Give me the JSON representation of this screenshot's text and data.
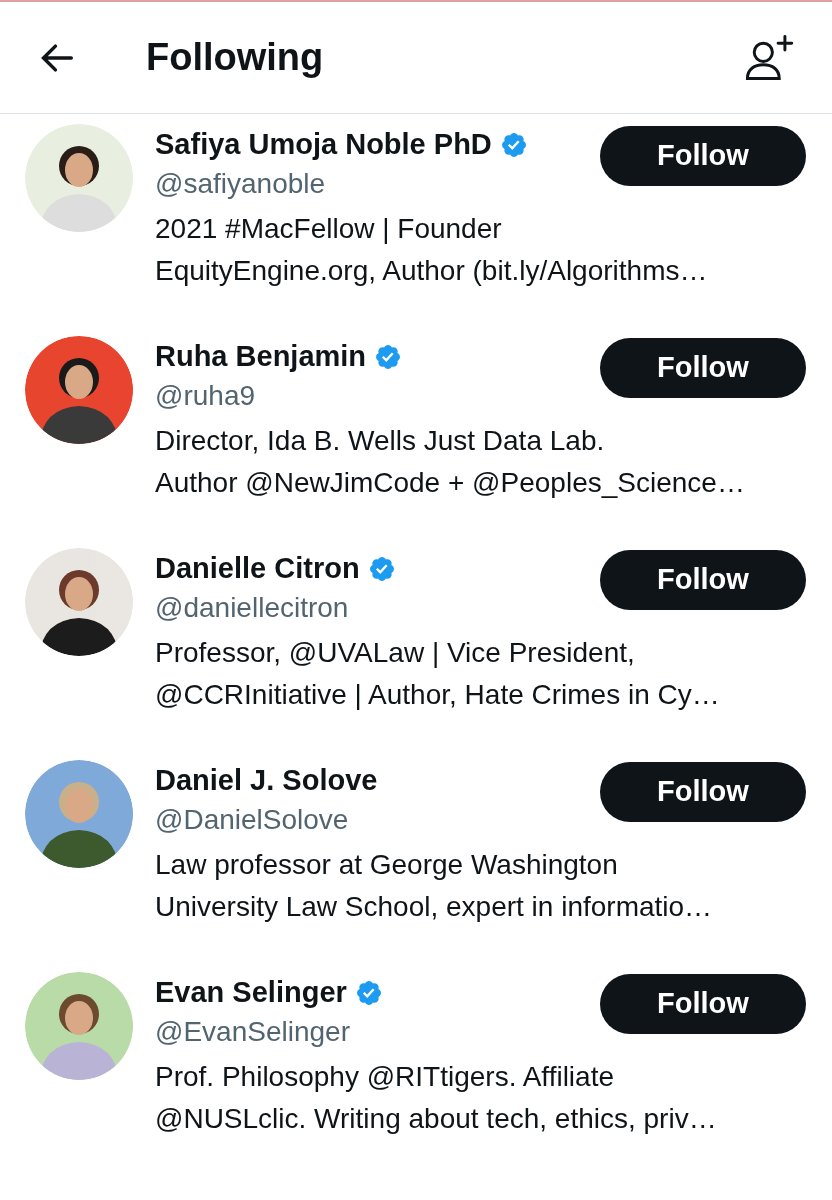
{
  "header": {
    "title": "Following"
  },
  "accounts": [
    {
      "name": "Safiya Umoja Noble PhD",
      "verified": true,
      "handle": "@safiyanoble",
      "bio_lines": [
        "2021 #MacFellow | Founder",
        "EquityEngine.org, Author (bit.ly/Algorithms…"
      ],
      "button": "Follow"
    },
    {
      "name": "Ruha Benjamin",
      "verified": true,
      "handle": "@ruha9",
      "bio_lines": [
        "Director, Ida B. Wells Just Data Lab.",
        "Author @NewJimCode + @Peoples_Science…"
      ],
      "button": "Follow"
    },
    {
      "name": "Danielle Citron",
      "verified": true,
      "handle": "@daniellecitron",
      "bio_lines": [
        "Professor, @UVALaw | Vice President,",
        "@CCRInitiative | Author, Hate Crimes in Cy…"
      ],
      "button": "Follow"
    },
    {
      "name": "Daniel J. Solove",
      "verified": false,
      "handle": "@DanielSolove",
      "bio_lines": [
        "Law professor at George Washington",
        "University Law School, expert in informatio…"
      ],
      "button": "Follow"
    },
    {
      "name": "Evan Selinger",
      "verified": true,
      "handle": "@EvanSelinger",
      "bio_lines": [
        "Prof. Philosophy @RITtigers. Affiliate",
        "@NUSLclic. Writing about tech, ethics, priv…"
      ],
      "button": "Follow"
    }
  ]
}
